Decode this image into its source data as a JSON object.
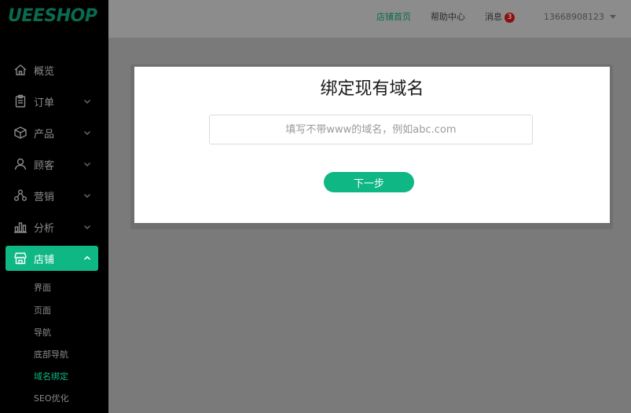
{
  "brand": {
    "logo_text": "UEESHOP",
    "accent": "#0fb784",
    "logo_color": "#0a6b4e"
  },
  "sidebar": {
    "items": [
      {
        "label": "概览",
        "icon": "home-icon",
        "expandable": false
      },
      {
        "label": "订单",
        "icon": "clipboard-icon",
        "expandable": true
      },
      {
        "label": "产品",
        "icon": "box-icon",
        "expandable": true
      },
      {
        "label": "顾客",
        "icon": "user-icon",
        "expandable": true
      },
      {
        "label": "营销",
        "icon": "nodes-icon",
        "expandable": true
      },
      {
        "label": "分析",
        "icon": "bar-chart-icon",
        "expandable": true
      },
      {
        "label": "店铺",
        "icon": "store-icon",
        "expandable": true,
        "active": true,
        "expanded": true
      }
    ],
    "sub_items": [
      {
        "label": "界面"
      },
      {
        "label": "页面"
      },
      {
        "label": "导航"
      },
      {
        "label": "底部导航"
      },
      {
        "label": "域名绑定",
        "active": true
      },
      {
        "label": "SEO优化"
      }
    ]
  },
  "header": {
    "store_home": "店铺首页",
    "help_center": "帮助中心",
    "messages": "消息",
    "message_count": "3",
    "username": "13668908123"
  },
  "dialog": {
    "title": "绑定现有域名",
    "domain_placeholder": "填写不带www的域名，例如abc.com",
    "domain_value": "",
    "next_label": "下一步"
  }
}
